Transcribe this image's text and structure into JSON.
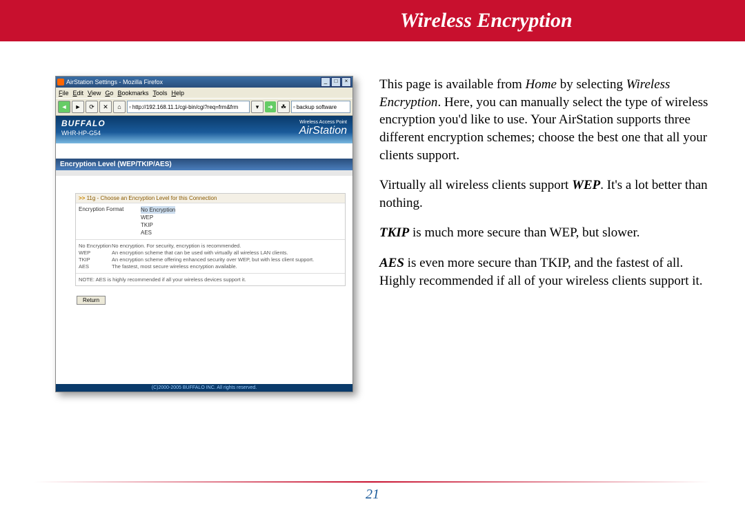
{
  "banner": {
    "title": "Wireless Encryption"
  },
  "body": {
    "p1_a": "This page is available from ",
    "p1_home": "Home",
    "p1_b": " by selecting ",
    "p1_link": "Wireless Encryption",
    "p1_c": ".  Here, you can manually select the type of wireless encryption you'd like to use.  Your AirStation supports three different encryption schemes; choose the best one that all your clients support.",
    "p2_a": "Virtually all wireless clients support ",
    "p2_wep": "WEP",
    "p2_b": ".  It's a lot better than nothing.",
    "p3_tkip": "TKIP",
    "p3_a": " is much more secure than WEP, but slower.",
    "p4_aes": "AES",
    "p4_a": " is even more secure than TKIP, and the fastest of all.  Highly recommended if all of your wireless clients support it."
  },
  "browser": {
    "window_title": "AirStation Settings - Mozilla Firefox",
    "menus": {
      "file": "File",
      "edit": "Edit",
      "view": "View",
      "go": "Go",
      "bookmarks": "Bookmarks",
      "tools": "Tools",
      "help": "Help"
    },
    "address": "http://192.168.11.1/cgi-bin/cgi?req=frm&frm",
    "backup_label": "backup software"
  },
  "router": {
    "brand": "BUFFALO",
    "model": "WHR-HP-G54",
    "ap_small": "Wireless Access Point",
    "ap_big": "AirStation",
    "section": "Encryption Level (WEP/TKIP/AES)",
    "panel_title": "11g - Choose an Encryption Level for this Connection",
    "enc_label": "Encryption Format",
    "opts": {
      "none": "No Encryption",
      "wep": "WEP",
      "tkip": "TKIP",
      "aes": "AES"
    },
    "desc": {
      "none_k": "No Encryption",
      "none_v": "No encryption. For security, encryption is recommended.",
      "wep_k": "WEP",
      "wep_v": "An encryption scheme that can be used with virtually all wireless LAN clients.",
      "tkip_k": "TKIP",
      "tkip_v": "An encryption scheme offering enhanced security over WEP, but with less client support.",
      "aes_k": "AES",
      "aes_v": "The fastest, most secure wireless encryption available."
    },
    "note": "NOTE: AES is highly recommended if all your wireless devices support it.",
    "return": "Return",
    "footer": "(C)2000-2005 BUFFALO INC. All rights reserved."
  },
  "page_number": "21"
}
